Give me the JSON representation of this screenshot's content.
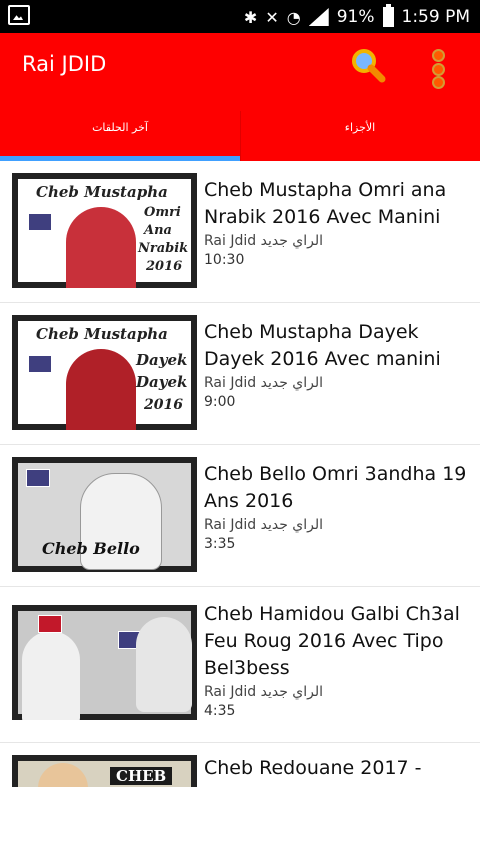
{
  "status_bar": {
    "battery_percent": "91%",
    "time": "1:59 PM"
  },
  "app": {
    "title": "Rai JDID"
  },
  "tabs": [
    {
      "label": "آخر الحلقات",
      "selected": true
    },
    {
      "label": "الأجزاء",
      "selected": false
    }
  ],
  "colors": {
    "appbar": "#fe0000",
    "tab_indicator": "#40a0ff"
  },
  "videos": [
    {
      "title": "Cheb Mustapha Omri ana Nrabik 2016 Avec Manini",
      "channel": "Rai Jdid الراي جديد",
      "duration": "10:30",
      "thumb_text": [
        "Cheb Mustapha",
        "Omri",
        "Ana",
        "Nrabik",
        "2016"
      ]
    },
    {
      "title": "Cheb Mustapha Dayek Dayek 2016 Avec manini",
      "channel": "Rai Jdid الراي جديد",
      "duration": "9:00",
      "thumb_text": [
        "Cheb Mustapha",
        "Dayek",
        "Dayek",
        "2016"
      ]
    },
    {
      "title": "Cheb Bello Omri 3andha 19 Ans 2016",
      "channel": "Rai Jdid الراي جديد",
      "duration": "3:35",
      "thumb_text": [
        "Cheb Bello"
      ]
    },
    {
      "title": "Cheb Hamidou Galbi Ch3al Feu Roug 2016 Avec Tipo Bel3bess",
      "channel": "Rai Jdid الراي جديد",
      "duration": "4:35",
      "thumb_text": []
    },
    {
      "title": "Cheb Redouane 2017 -",
      "channel": "",
      "duration": "",
      "thumb_text": [
        "CHEB"
      ]
    }
  ]
}
